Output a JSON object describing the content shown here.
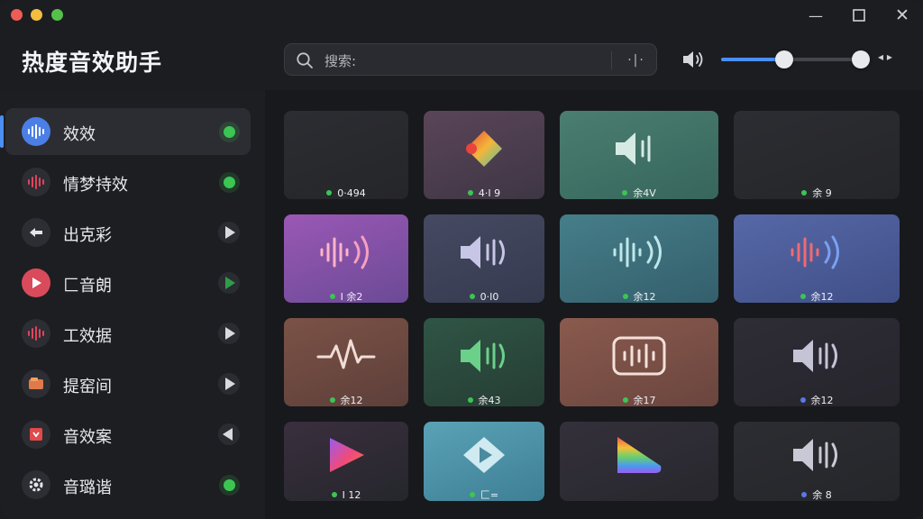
{
  "window": {
    "controls": {
      "minimize_glyph": "—",
      "maximize_glyph": "☐",
      "close_glyph": "✕"
    }
  },
  "header": {
    "app_title": "热度音效助手",
    "search": {
      "value": "搜索:",
      "icon": "search-icon",
      "action_glyph": "·|·"
    },
    "volume": {
      "icon": "speaker-icon",
      "level": 0.45,
      "arrows": "◂ ▸"
    }
  },
  "sidebar": {
    "items": [
      {
        "label": "效效",
        "icon": "waveform-icon",
        "status": "active-dot",
        "active": true
      },
      {
        "label": "情梦持效",
        "icon": "waveform-icon",
        "status": "active-dot"
      },
      {
        "label": "出克彩",
        "icon": "arrow-left-icon",
        "status": "play"
      },
      {
        "label": "匚音朗",
        "icon": "play-icon",
        "status": "play-green"
      },
      {
        "label": "工效据",
        "icon": "waveform-icon",
        "status": "play"
      },
      {
        "label": "提窑间",
        "icon": "folder-icon",
        "status": "play"
      },
      {
        "label": "音效案",
        "icon": "box-icon",
        "status": "back"
      },
      {
        "label": "音璐谐",
        "icon": "gear-icon",
        "status": "active-dot"
      }
    ]
  },
  "colors": {
    "accent": "#4b8ff3",
    "status_green": "#3cc553",
    "background": "#1c1d21"
  },
  "grid": {
    "cards": [
      {
        "caption": "0·494",
        "icon": "waveform-icon",
        "bg": "#2a2b30",
        "dot": "green"
      },
      {
        "caption": "4·I 9",
        "icon": "diamond-icon",
        "bg": "#4f3e4e",
        "dot": "green"
      },
      {
        "caption": "余4V",
        "icon": "speaker-icon",
        "bg": "#3f7064",
        "dot": "green"
      },
      {
        "caption": "余 9",
        "icon": "waveform-icon",
        "bg": "#2a2b30",
        "dot": "green"
      },
      {
        "caption": "I 余2",
        "icon": "speaker-waves-icon",
        "bg": "#7e52a3",
        "dot": "green"
      },
      {
        "caption": "0·I0",
        "icon": "speaker-icon",
        "bg": "#3d4156",
        "dot": "green"
      },
      {
        "caption": "余12",
        "icon": "speaker-waves-icon",
        "bg": "#3c6e7a",
        "dot": "green"
      },
      {
        "caption": "余12",
        "icon": "speaker-waves-icon",
        "bg": "#4a5a92",
        "dot": "green"
      },
      {
        "caption": "余12",
        "icon": "pulse-icon",
        "bg": "#6a4a42",
        "dot": "green"
      },
      {
        "caption": "余43",
        "icon": "speaker-icon",
        "bg": "#2e4b3e",
        "dot": "green"
      },
      {
        "caption": "余17",
        "icon": "audio-frame-icon",
        "bg": "#7a5148",
        "dot": "green"
      },
      {
        "caption": "余12",
        "icon": "speaker-icon",
        "bg": "#2c2a33",
        "dot": "blue"
      },
      {
        "caption": "I 12",
        "icon": "play-icon",
        "bg": "#2e2c36",
        "dot": "green"
      },
      {
        "caption": "匚=",
        "icon": "diamond-play-icon",
        "bg": "#4c8a9e",
        "dot": "green"
      },
      {
        "caption": "",
        "icon": "rainbow-triangle-icon",
        "bg": "#2c2b32",
        "dot": ""
      },
      {
        "caption": "余 8",
        "icon": "speaker-icon",
        "bg": "#2a2b30",
        "dot": "blue"
      }
    ]
  }
}
